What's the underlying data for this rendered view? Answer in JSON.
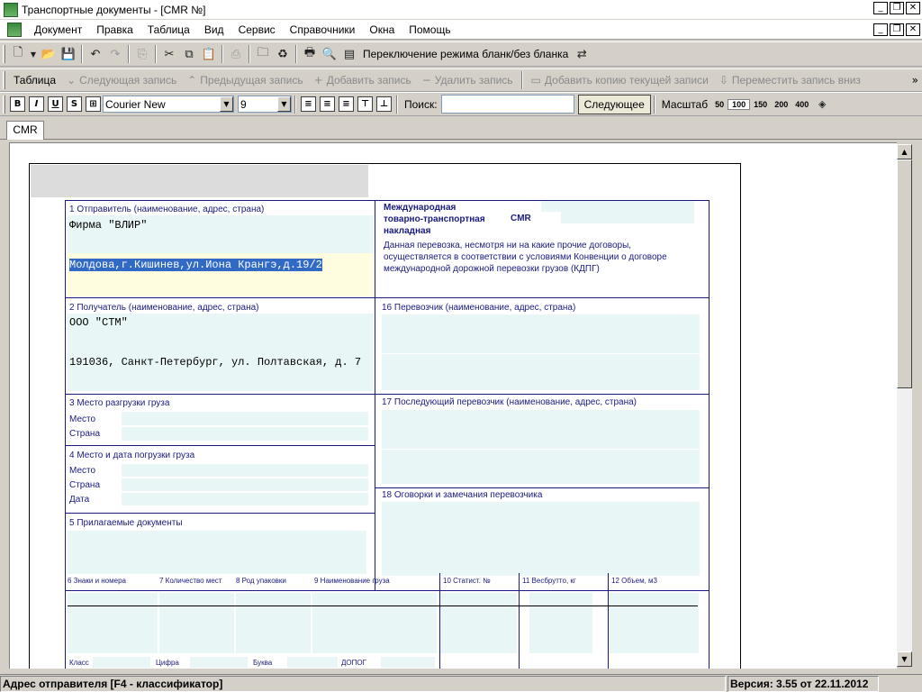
{
  "window": {
    "title": "Транспортные документы - [CMR №]"
  },
  "menu": [
    "Документ",
    "Правка",
    "Таблица",
    "Вид",
    "Сервис",
    "Справочники",
    "Окна",
    "Помощь"
  ],
  "toolbar1": {
    "mode_toggle_label": "Переключение режима бланк/без бланка"
  },
  "toolbar2": {
    "table_label": "Таблица",
    "next_record": "Следующая запись",
    "prev_record": "Предыдущая запись",
    "add_record": "Добавить запись",
    "delete_record": "Удалить запись",
    "add_copy": "Добавить копию текущей записи",
    "move_down": "Переместить запись вниз"
  },
  "toolbar3": {
    "font_name": "Courier New",
    "font_size": "9",
    "search_label": "Поиск:",
    "search_value": "",
    "next_button": "Следующее",
    "scale_label": "Масштаб",
    "scale_options": [
      "50",
      "100",
      "150",
      "200",
      "400"
    ],
    "scale_active": "100"
  },
  "tabs": [
    "CMR"
  ],
  "form": {
    "sender_label": "1 Отправитель (наименование, адрес, страна)",
    "sender_name": "Фирма \"ВЛИР\"",
    "sender_address": "Молдова,г.Кишинев,ул.Иона Крангэ,д.19/2",
    "header_title_1": "Международная",
    "header_title_2": "товарно-транспортная",
    "header_title_3": "накладная",
    "header_cmr": "CMR",
    "header_desc_1": "Данная перевозка, несмотря ни на какие прочие договоры,",
    "header_desc_2": "осуществляется в соответствии с условиями Конвенции о договоре",
    "header_desc_3": "международной дорожной перевозки грузов (КДПГ)",
    "consignee_label": "2 Получатель (наименование, адрес, страна)",
    "consignee_name": "ООО \"СТМ\"",
    "consignee_address": "191036, Санкт-Петербург, ул. Полтавская, д. 7",
    "carrier_label": "16 Перевозчик (наименование, адрес, страна)",
    "unload_label": "3 Место разгрузки груза",
    "unload_place": "Место",
    "unload_country": "Страна",
    "next_carrier_label": "17 Последующий перевозчик (наименование, адрес, страна)",
    "load_label": "4 Место и дата погрузки груза",
    "load_place": "Место",
    "load_country": "Страна",
    "load_date": "Дата",
    "carrier_remarks_label": "18 Оговорки и замечания перевозчика",
    "docs_label": "5 Прилагаемые документы",
    "col6": "6 Знаки и номера",
    "col7": "7 Количество мест",
    "col8": "8 Род упаковки",
    "col9": "9 Наименование груза",
    "col10": "10 Статист. №",
    "col11": "11 Весбрутто, кг",
    "col12": "12 Объем, м3",
    "bottom_class": "Класс",
    "bottom_digit": "Цифра",
    "bottom_letter": "Буква",
    "bottom_adr": "ДОПОГ"
  },
  "status": {
    "left": "Адрес отправителя [F4 - классификатор]",
    "right": "Версия: 3.55 от 22.11.2012"
  }
}
